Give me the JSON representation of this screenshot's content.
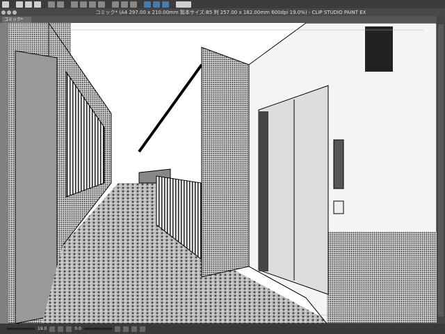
{
  "app": {
    "title": "コミック* (A4 297.00 x 210.00mm 製本サイズ:B5 判 257.00 x 182.00mm 600dpi 19.0%) - CLIP STUDIO PAINT EX"
  },
  "tab": {
    "label": "コミック*"
  },
  "toolbar": {
    "icons": [
      "clip-studio-logo",
      "new-file",
      "open-file",
      "save",
      "undo",
      "redo",
      "selection",
      "transform",
      "fill",
      "crop",
      "ruler",
      "perspective",
      "snap",
      "help"
    ]
  },
  "status": {
    "zoom": "19.0",
    "rotation": "0.0"
  }
}
